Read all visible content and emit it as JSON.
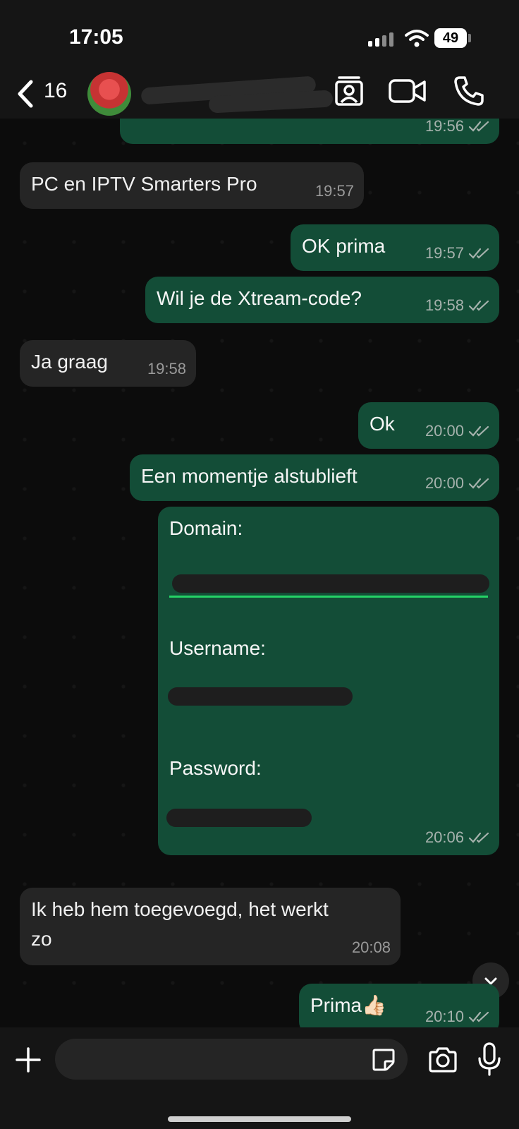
{
  "status": {
    "time": "17:05",
    "battery": "49"
  },
  "header": {
    "back_count": "16"
  },
  "messages": [
    {
      "dir": "out",
      "text": "",
      "time": "19:56"
    },
    {
      "dir": "in",
      "text": "PC en IPTV Smarters Pro",
      "time": "19:57"
    },
    {
      "dir": "out",
      "text": "OK prima",
      "time": "19:57"
    },
    {
      "dir": "out",
      "text": "Wil je de Xtream-code?",
      "time": "19:58"
    },
    {
      "dir": "in",
      "text": "Ja graag",
      "time": "19:58"
    },
    {
      "dir": "out",
      "text": "Ok",
      "time": "20:00"
    },
    {
      "dir": "out",
      "text": "Een momentje alstublieft",
      "time": "20:00"
    },
    {
      "dir": "out",
      "domain_label": "Domain:",
      "username_label": "Username:",
      "password_label": "Password:",
      "time": "20:06"
    },
    {
      "dir": "in",
      "text_line1": "Ik heb hem toegevoegd, het werkt",
      "text_line2": "zo",
      "time": "20:08"
    },
    {
      "dir": "out",
      "text": "Prima👍🏻",
      "time": "20:10"
    }
  ],
  "input": {
    "placeholder": ""
  },
  "colors": {
    "outgoing": "#134d37",
    "incoming": "#252525",
    "link": "#25d366"
  }
}
